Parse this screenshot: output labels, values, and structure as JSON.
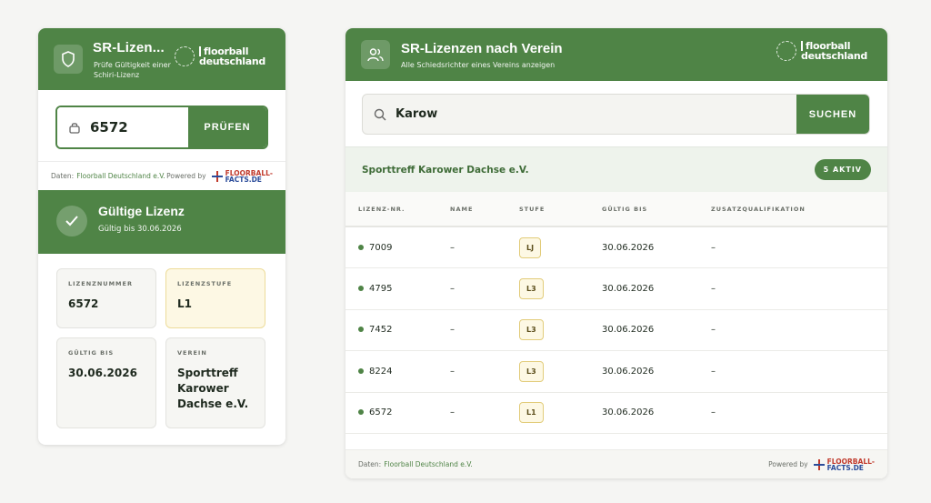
{
  "left_card": {
    "title": "SR-Lizen...",
    "subtitle": "Prüfe Gültigkeit einer Schiri-Lizenz",
    "logo_line1": "floorball",
    "logo_line2": "deutschland",
    "input_value": "6572",
    "check_button": "PRÜFEN",
    "footer_data_label": "Daten:",
    "footer_data_link": "Floorball Deutschland e.V.",
    "footer_powered": "Powered by",
    "ff_line1": "FLOORBALL-",
    "ff_line2": "FACTS.DE",
    "result_title": "Gültige Lizenz",
    "result_subtitle": "Gültig bis 30.06.2026",
    "tiles": [
      {
        "label": "LIZENZNUMMER",
        "value": "6572"
      },
      {
        "label": "LIZENZSTUFE",
        "value": "L1"
      },
      {
        "label": "GÜLTIG BIS",
        "value": "30.06.2026"
      },
      {
        "label": "VEREIN",
        "value": "Sporttreff Karower Dachse e.V."
      }
    ]
  },
  "right_card": {
    "title": "SR-Lizenzen nach Verein",
    "subtitle": "Alle Schiedsrichter eines Vereins anzeigen",
    "logo_line1": "floorball",
    "logo_line2": "deutschland",
    "search_value": "Karow",
    "search_button": "SUCHEN",
    "club_name": "Sporttreff Karower Dachse e.V.",
    "active_badge": "5 AKTIV",
    "columns": [
      "LIZENZ-NR.",
      "NAME",
      "STUFE",
      "GÜLTIG BIS",
      "ZUSATZQUALIFIKATION"
    ],
    "rows": [
      {
        "nr": "7009",
        "name": "–",
        "stufe": "LJ",
        "gueltig": "30.06.2026",
        "zusatz": "–"
      },
      {
        "nr": "4795",
        "name": "–",
        "stufe": "L3",
        "gueltig": "30.06.2026",
        "zusatz": "–"
      },
      {
        "nr": "7452",
        "name": "–",
        "stufe": "L3",
        "gueltig": "30.06.2026",
        "zusatz": "–"
      },
      {
        "nr": "8224",
        "name": "–",
        "stufe": "L3",
        "gueltig": "30.06.2026",
        "zusatz": "–"
      },
      {
        "nr": "6572",
        "name": "–",
        "stufe": "L1",
        "gueltig": "30.06.2026",
        "zusatz": "–"
      }
    ],
    "footer_data_label": "Daten:",
    "footer_data_link": "Floorball Deutschland e.V.",
    "footer_powered": "Powered by",
    "ff_line1": "FLOORBALL-",
    "ff_line2": "FACTS.DE"
  },
  "colors": {
    "brand_green": "#4f8446",
    "tile_yellow": "#fdf8e4",
    "background": "#f5f5f3"
  }
}
